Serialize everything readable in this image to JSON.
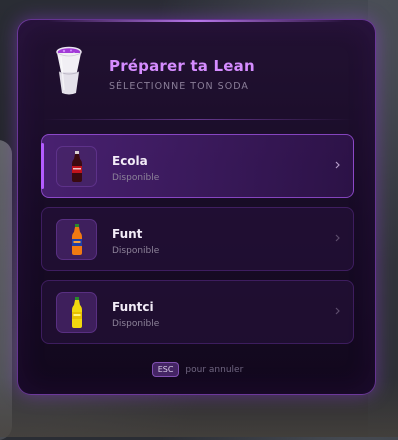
{
  "header": {
    "title": "Préparer ta Lean",
    "subtitle": "SÉLECTIONNE TON SODA",
    "icon": "double-cup-icon"
  },
  "options": [
    {
      "name": "Ecola",
      "status": "Disponible",
      "icon": "cola-bottle-icon",
      "color": "#c0131c",
      "selected": true
    },
    {
      "name": "Funt",
      "status": "Disponible",
      "icon": "orange-soda-bottle-icon",
      "color": "#f07a12",
      "selected": false
    },
    {
      "name": "Funtci",
      "status": "Disponible",
      "icon": "lemon-soda-bottle-icon",
      "color": "#f2d80e",
      "selected": false
    }
  ],
  "footer": {
    "key": "ESC",
    "text": "pour annuler"
  },
  "colors": {
    "accent": "#d58cff",
    "panel_border": "#aa5af0",
    "panel_bg": "#170b25"
  }
}
